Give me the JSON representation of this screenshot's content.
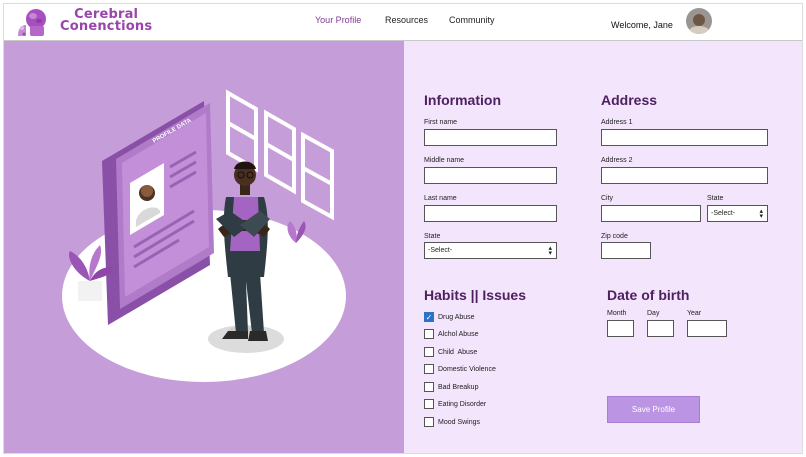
{
  "brand": {
    "line1": "Cerebral",
    "line2": "Conenctions"
  },
  "nav": {
    "profile": "Your Profile",
    "resources": "Resources",
    "community": "Community"
  },
  "user": {
    "welcome": "Welcome, Jane"
  },
  "illustration": {
    "board_title": "PROFILE DATA"
  },
  "information": {
    "title": "Information",
    "first_name_label": "First name",
    "middle_name_label": "Middle name",
    "last_name_label": "Last name",
    "state_label": "State",
    "state_value": "-Select-"
  },
  "address": {
    "title": "Address",
    "address1_label": "Address 1",
    "address2_label": "Address 2",
    "city_label": "City",
    "state_label": "State",
    "state_value": "-Select-",
    "zip_label": "Zip code"
  },
  "habits": {
    "title": "Habits || Issues",
    "items": [
      {
        "label": "Drug Abuse",
        "checked": true
      },
      {
        "label": "Alchol Abuse",
        "checked": false
      },
      {
        "label": "Child  Abuse",
        "checked": false
      },
      {
        "label": "Domestic Violence",
        "checked": false
      },
      {
        "label": "Bad Breakup",
        "checked": false
      },
      {
        "label": "Eating Disorder",
        "checked": false
      },
      {
        "label": "Mood Swings",
        "checked": false
      }
    ]
  },
  "dob": {
    "title": "Date of birth",
    "month_label": "Month",
    "day_label": "Day",
    "year_label": "Year"
  },
  "actions": {
    "save_label": "Save Profile"
  },
  "colors": {
    "accent": "#7d3a94",
    "panel_left": "#c59dd8",
    "panel_right": "#f3e5fc",
    "button": "#bb94e3"
  }
}
